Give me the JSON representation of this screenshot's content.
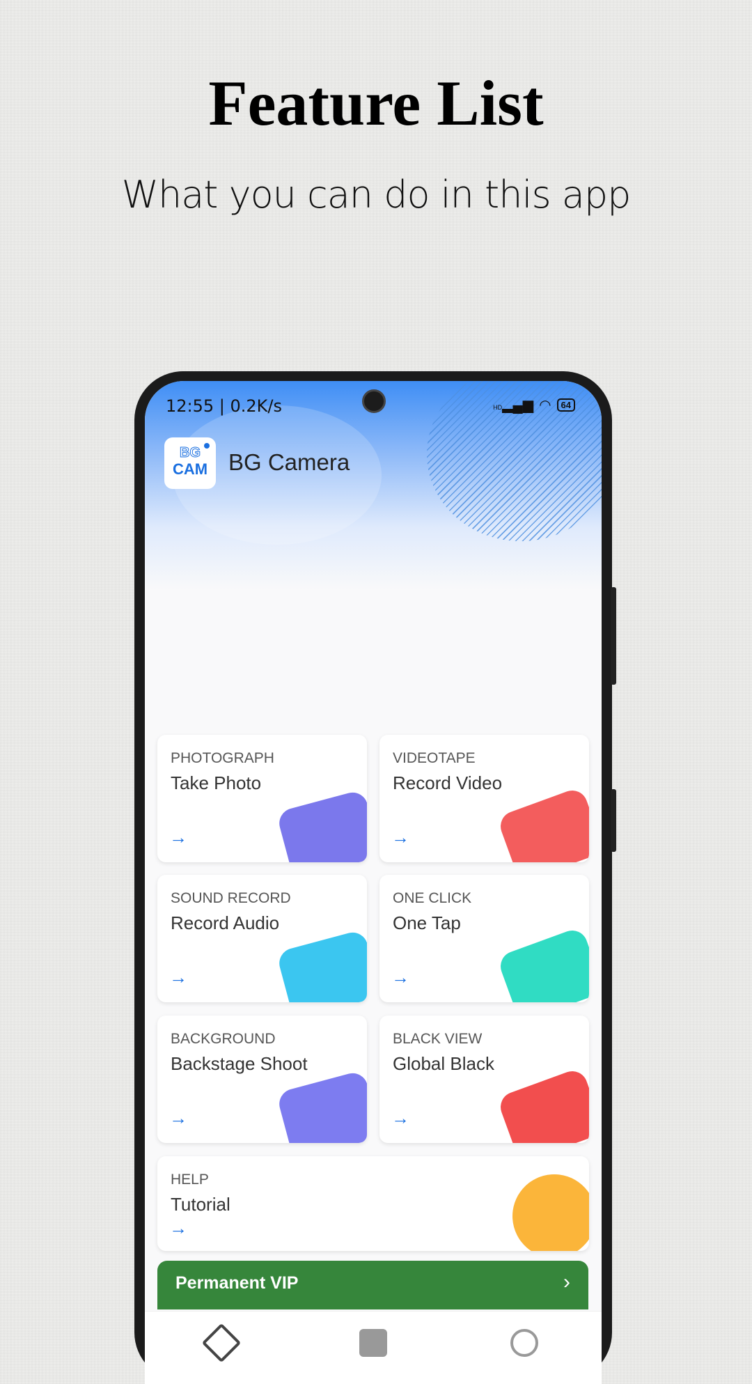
{
  "promo": {
    "title": "Feature List",
    "subtitle": "What you can do in this app"
  },
  "status": {
    "time_speed": "12:55 | 0.2K/s",
    "signal": "HD",
    "battery": "64"
  },
  "app": {
    "logo_top": "BG",
    "logo_bottom": "CAM",
    "name": "BG Camera"
  },
  "cards": [
    {
      "label": "PHOTOGRAPH",
      "title": "Take Photo",
      "arrow": "→",
      "icon": "camera-icon",
      "color": "#7b78ec"
    },
    {
      "label": "VIDEOTAPE",
      "title": "Record Video",
      "arrow": "→",
      "icon": "video-camera-icon",
      "color": "#f35d5d"
    },
    {
      "label": "SOUND RECORD",
      "title": "Record Audio",
      "arrow": "→",
      "icon": "microphone-icon",
      "color": "#3bc6f0"
    },
    {
      "label": "ONE CLICK",
      "title": "One Tap",
      "arrow": "→",
      "icon": "tap-icon",
      "color": "#30dcc3"
    },
    {
      "label": "BACKGROUND",
      "title": "Backstage Shoot",
      "arrow": "→",
      "icon": "background-icon",
      "color": "#7d7cf0"
    },
    {
      "label": "BLACK VIEW",
      "title": "Global Black",
      "arrow": "→",
      "icon": "power-icon",
      "color": "#f24e4e"
    },
    {
      "label": "HELP",
      "title": "Tutorial",
      "arrow": "→",
      "icon": "question-icon",
      "color": "#fbb53a"
    }
  ],
  "vip": {
    "label": "Permanent VIP",
    "chevron": "›"
  },
  "nav": {
    "items": [
      "home-icon",
      "folder-icon",
      "profile-icon"
    ]
  }
}
